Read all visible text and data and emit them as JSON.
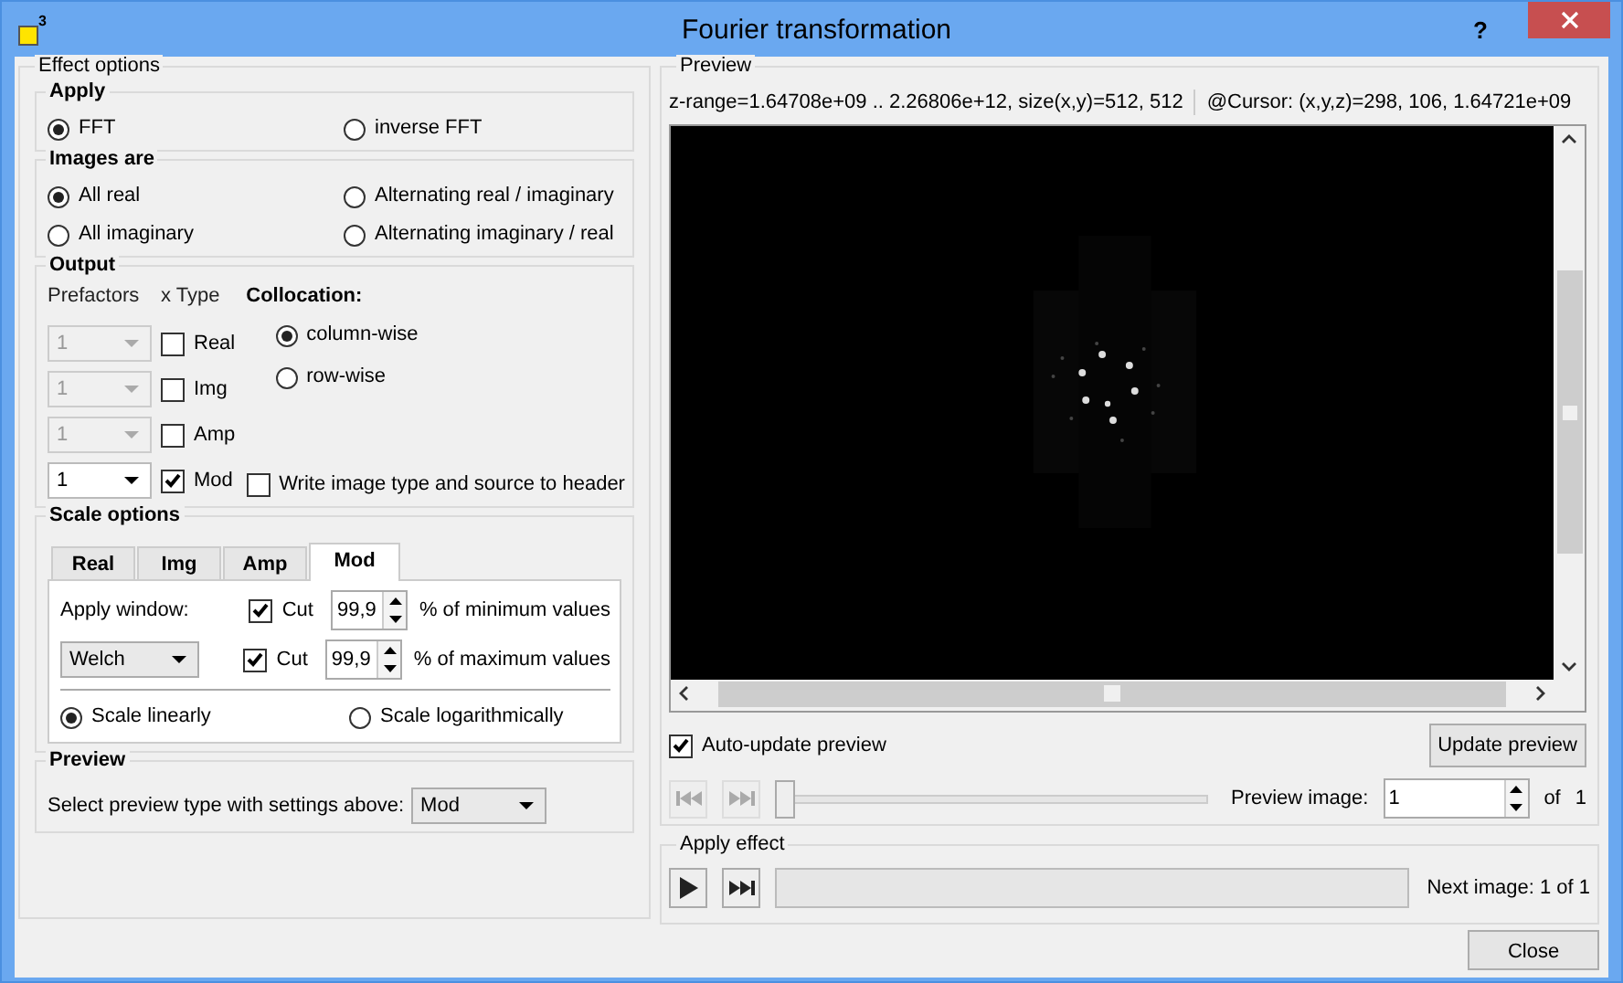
{
  "window": {
    "title": "Fourier transformation",
    "badge": "3",
    "help": "?"
  },
  "effect_options": {
    "title": "Effect options",
    "apply": {
      "title": "Apply",
      "options": [
        {
          "label": "FFT",
          "selected": true
        },
        {
          "label": "inverse FFT",
          "selected": false
        }
      ]
    },
    "images_are": {
      "title": "Images are",
      "options": [
        {
          "label": "All real",
          "selected": true
        },
        {
          "label": "Alternating real / imaginary",
          "selected": false
        },
        {
          "label": "All imaginary",
          "selected": false
        },
        {
          "label": "Alternating imaginary / real",
          "selected": false
        }
      ]
    },
    "output": {
      "title": "Output",
      "prefactors_label": "Prefactors",
      "type_label": "x Type",
      "rows": [
        {
          "prefactor": "1",
          "disabled": true,
          "type": "Real",
          "checked": false
        },
        {
          "prefactor": "1",
          "disabled": true,
          "type": "Img",
          "checked": false
        },
        {
          "prefactor": "1",
          "disabled": true,
          "type": "Amp",
          "checked": false
        },
        {
          "prefactor": "1",
          "disabled": false,
          "type": "Mod",
          "checked": true
        }
      ],
      "collocation": {
        "title": "Collocation:",
        "options": [
          {
            "label": "column-wise",
            "selected": true
          },
          {
            "label": "row-wise",
            "selected": false
          }
        ]
      },
      "header_option": {
        "label": "Write image type and source to header",
        "checked": false
      }
    },
    "scale_options": {
      "title": "Scale options",
      "tabs": [
        {
          "label": "Real",
          "selected": false
        },
        {
          "label": "Img",
          "selected": false
        },
        {
          "label": "Amp",
          "selected": false
        },
        {
          "label": "Mod",
          "selected": true
        }
      ],
      "apply_window_label": "Apply window:",
      "window_select": "Welch",
      "cuts": [
        {
          "label": "Cut",
          "checked": true,
          "value": "99,9",
          "suffix": "% of minimum values"
        },
        {
          "label": "Cut",
          "checked": true,
          "value": "99,9",
          "suffix": "% of maximum values"
        }
      ],
      "scales": [
        {
          "label": "Scale linearly",
          "selected": true
        },
        {
          "label": "Scale logarithmically",
          "selected": false
        }
      ]
    },
    "preview": {
      "title": "Preview",
      "label": "Select preview type with settings above:",
      "select": "Mod"
    }
  },
  "preview_panel": {
    "title": "Preview",
    "z_range": "z-range=1.64708e+09 .. 2.26806e+12, size(x,y)=512, 512",
    "cursor": "@Cursor: (x,y,z)=298, 106, 1.64721e+09",
    "auto_update": {
      "label": "Auto-update preview",
      "checked": true
    },
    "update_button": "Update preview",
    "nav_disabled": true,
    "slider": {
      "level": 0
    },
    "preview_image_label": "Preview image:",
    "preview_image_value": "1",
    "of_label": "of",
    "of_value": "1"
  },
  "apply_effect": {
    "title": "Apply effect",
    "progress": {
      "level": 0
    },
    "next_image": "Next image: 1 of 1"
  },
  "close_button": "Close"
}
